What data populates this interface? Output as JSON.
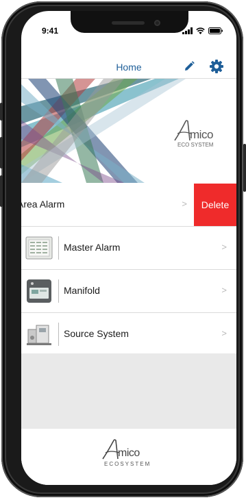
{
  "status_bar": {
    "time": "9:41"
  },
  "nav": {
    "title": "Home"
  },
  "banner": {
    "logo_text": "mico",
    "logo_sub": "ECO SYSTEM"
  },
  "rows": [
    {
      "label": "Area Alarm",
      "action": "Delete",
      "chevron": ">"
    },
    {
      "label": "Master Alarm",
      "chevron": ">"
    },
    {
      "label": "Manifold",
      "chevron": ">"
    },
    {
      "label": "Source System",
      "chevron": ">"
    }
  ],
  "footer": {
    "logo_text": "mico",
    "logo_sub": "ECOSYSTEM"
  },
  "colors": {
    "nav_title": "#1f5f99",
    "icon": "#1f5f99",
    "delete": "#ef2b2b",
    "empty_area": "#e9e9e9"
  },
  "icons": [
    "pencil-icon",
    "gear-icon",
    "signal-icon",
    "wifi-icon",
    "battery-icon",
    "chevron-right-icon"
  ]
}
